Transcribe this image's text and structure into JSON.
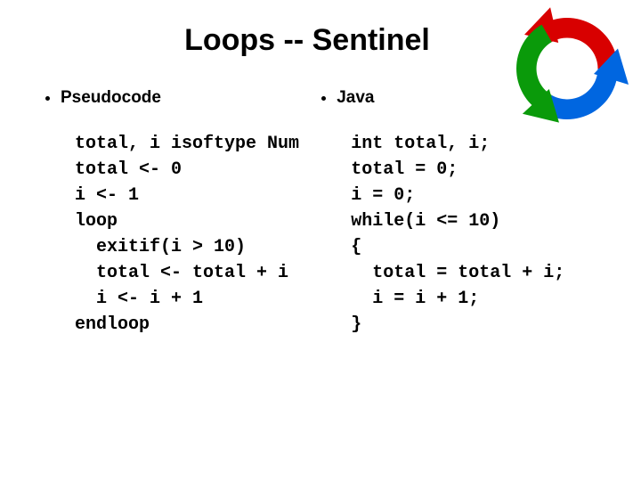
{
  "title": "Loops -- Sentinel",
  "left": {
    "heading": "Pseudocode",
    "code": "total, i isoftype Num\ntotal <- 0\ni <- 1\nloop\n  exitif(i > 10)\n  total <- total + i\n  i <- i + 1\nendloop"
  },
  "right": {
    "heading": "Java",
    "code": "int total, i;\ntotal = 0;\ni = 0;\nwhile(i <= 10)\n{\n  total = total + i;\n  i = i + 1;\n}"
  },
  "icon": "cycle-arrows"
}
